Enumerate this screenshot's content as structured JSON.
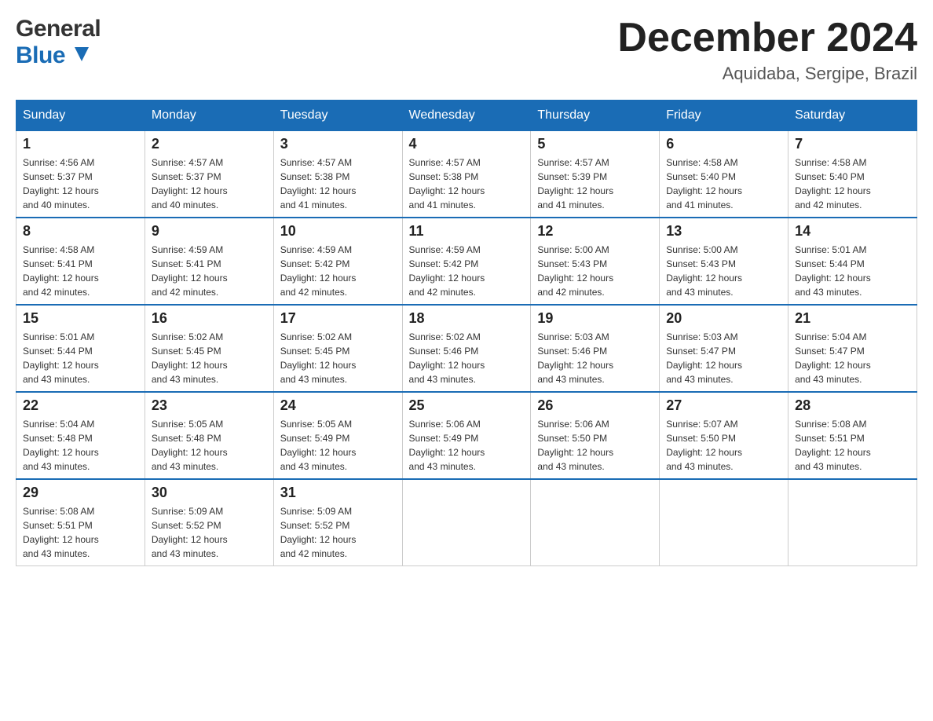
{
  "header": {
    "logo_line1": "General",
    "logo_line2": "Blue",
    "month_year": "December 2024",
    "location": "Aquidaba, Sergipe, Brazil"
  },
  "days_of_week": [
    "Sunday",
    "Monday",
    "Tuesday",
    "Wednesday",
    "Thursday",
    "Friday",
    "Saturday"
  ],
  "weeks": [
    [
      {
        "day": "1",
        "sunrise": "4:56 AM",
        "sunset": "5:37 PM",
        "daylight": "12 hours and 40 minutes."
      },
      {
        "day": "2",
        "sunrise": "4:57 AM",
        "sunset": "5:37 PM",
        "daylight": "12 hours and 40 minutes."
      },
      {
        "day": "3",
        "sunrise": "4:57 AM",
        "sunset": "5:38 PM",
        "daylight": "12 hours and 41 minutes."
      },
      {
        "day": "4",
        "sunrise": "4:57 AM",
        "sunset": "5:38 PM",
        "daylight": "12 hours and 41 minutes."
      },
      {
        "day": "5",
        "sunrise": "4:57 AM",
        "sunset": "5:39 PM",
        "daylight": "12 hours and 41 minutes."
      },
      {
        "day": "6",
        "sunrise": "4:58 AM",
        "sunset": "5:40 PM",
        "daylight": "12 hours and 41 minutes."
      },
      {
        "day": "7",
        "sunrise": "4:58 AM",
        "sunset": "5:40 PM",
        "daylight": "12 hours and 42 minutes."
      }
    ],
    [
      {
        "day": "8",
        "sunrise": "4:58 AM",
        "sunset": "5:41 PM",
        "daylight": "12 hours and 42 minutes."
      },
      {
        "day": "9",
        "sunrise": "4:59 AM",
        "sunset": "5:41 PM",
        "daylight": "12 hours and 42 minutes."
      },
      {
        "day": "10",
        "sunrise": "4:59 AM",
        "sunset": "5:42 PM",
        "daylight": "12 hours and 42 minutes."
      },
      {
        "day": "11",
        "sunrise": "4:59 AM",
        "sunset": "5:42 PM",
        "daylight": "12 hours and 42 minutes."
      },
      {
        "day": "12",
        "sunrise": "5:00 AM",
        "sunset": "5:43 PM",
        "daylight": "12 hours and 42 minutes."
      },
      {
        "day": "13",
        "sunrise": "5:00 AM",
        "sunset": "5:43 PM",
        "daylight": "12 hours and 43 minutes."
      },
      {
        "day": "14",
        "sunrise": "5:01 AM",
        "sunset": "5:44 PM",
        "daylight": "12 hours and 43 minutes."
      }
    ],
    [
      {
        "day": "15",
        "sunrise": "5:01 AM",
        "sunset": "5:44 PM",
        "daylight": "12 hours and 43 minutes."
      },
      {
        "day": "16",
        "sunrise": "5:02 AM",
        "sunset": "5:45 PM",
        "daylight": "12 hours and 43 minutes."
      },
      {
        "day": "17",
        "sunrise": "5:02 AM",
        "sunset": "5:45 PM",
        "daylight": "12 hours and 43 minutes."
      },
      {
        "day": "18",
        "sunrise": "5:02 AM",
        "sunset": "5:46 PM",
        "daylight": "12 hours and 43 minutes."
      },
      {
        "day": "19",
        "sunrise": "5:03 AM",
        "sunset": "5:46 PM",
        "daylight": "12 hours and 43 minutes."
      },
      {
        "day": "20",
        "sunrise": "5:03 AM",
        "sunset": "5:47 PM",
        "daylight": "12 hours and 43 minutes."
      },
      {
        "day": "21",
        "sunrise": "5:04 AM",
        "sunset": "5:47 PM",
        "daylight": "12 hours and 43 minutes."
      }
    ],
    [
      {
        "day": "22",
        "sunrise": "5:04 AM",
        "sunset": "5:48 PM",
        "daylight": "12 hours and 43 minutes."
      },
      {
        "day": "23",
        "sunrise": "5:05 AM",
        "sunset": "5:48 PM",
        "daylight": "12 hours and 43 minutes."
      },
      {
        "day": "24",
        "sunrise": "5:05 AM",
        "sunset": "5:49 PM",
        "daylight": "12 hours and 43 minutes."
      },
      {
        "day": "25",
        "sunrise": "5:06 AM",
        "sunset": "5:49 PM",
        "daylight": "12 hours and 43 minutes."
      },
      {
        "day": "26",
        "sunrise": "5:06 AM",
        "sunset": "5:50 PM",
        "daylight": "12 hours and 43 minutes."
      },
      {
        "day": "27",
        "sunrise": "5:07 AM",
        "sunset": "5:50 PM",
        "daylight": "12 hours and 43 minutes."
      },
      {
        "day": "28",
        "sunrise": "5:08 AM",
        "sunset": "5:51 PM",
        "daylight": "12 hours and 43 minutes."
      }
    ],
    [
      {
        "day": "29",
        "sunrise": "5:08 AM",
        "sunset": "5:51 PM",
        "daylight": "12 hours and 43 minutes."
      },
      {
        "day": "30",
        "sunrise": "5:09 AM",
        "sunset": "5:52 PM",
        "daylight": "12 hours and 43 minutes."
      },
      {
        "day": "31",
        "sunrise": "5:09 AM",
        "sunset": "5:52 PM",
        "daylight": "12 hours and 42 minutes."
      },
      null,
      null,
      null,
      null
    ]
  ],
  "labels": {
    "sunrise": "Sunrise:",
    "sunset": "Sunset:",
    "daylight": "Daylight:"
  }
}
